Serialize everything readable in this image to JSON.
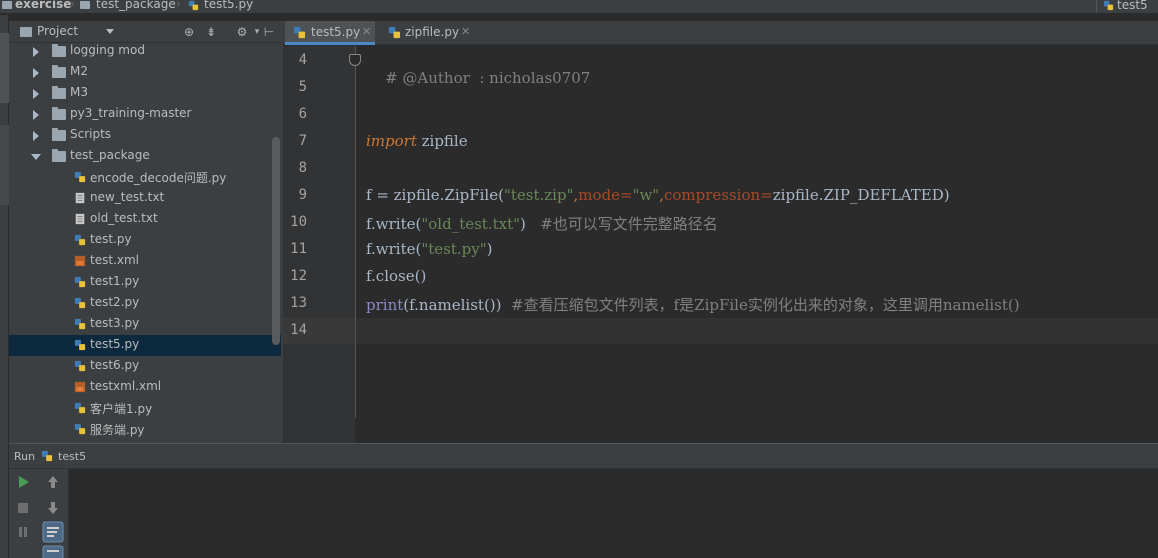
{
  "navbar": {
    "crumbs": [
      "exercise",
      "test_package",
      "test5.py"
    ],
    "run_config": "test5"
  },
  "project_panel": {
    "title": "Project",
    "tree": [
      {
        "label": "logging mod",
        "type": "folder",
        "expanded": false
      },
      {
        "label": "M2",
        "type": "folder",
        "expanded": false
      },
      {
        "label": "M3",
        "type": "folder",
        "expanded": false
      },
      {
        "label": "py3_training-master",
        "type": "folder",
        "expanded": false
      },
      {
        "label": "Scripts",
        "type": "folder",
        "expanded": false
      },
      {
        "label": "test_package",
        "type": "folder",
        "expanded": true
      },
      {
        "label": "encode_decode问题.py",
        "type": "py"
      },
      {
        "label": "new_test.txt",
        "type": "txt"
      },
      {
        "label": "old_test.txt",
        "type": "txt"
      },
      {
        "label": "test.py",
        "type": "py"
      },
      {
        "label": "test.xml",
        "type": "xml"
      },
      {
        "label": "test1.py",
        "type": "py"
      },
      {
        "label": "test2.py",
        "type": "py"
      },
      {
        "label": "test3.py",
        "type": "py"
      },
      {
        "label": "test5.py",
        "type": "py",
        "selected": true
      },
      {
        "label": "test6.py",
        "type": "py"
      },
      {
        "label": "testxml.xml",
        "type": "xml"
      },
      {
        "label": "客户端1.py",
        "type": "py"
      },
      {
        "label": "服务端.py",
        "type": "py"
      }
    ]
  },
  "tabs": [
    {
      "label": "test5.py",
      "active": true
    },
    {
      "label": "zipfile.py",
      "active": false
    }
  ],
  "editor": {
    "line_numbers": [
      "4",
      "5",
      "6",
      "7",
      "8",
      "9",
      "10",
      "11",
      "12",
      "13",
      "14"
    ],
    "lines": {
      "l4": "# @Author  : nicholas0707",
      "l7_kw": "import",
      "l7_rest": " zipfile",
      "l9_a": "f = zipfile.",
      "l9_cls": "ZipFile",
      "l9_b": "(",
      "l9_s1": "\"test.zip\"",
      "l9_c": ",",
      "l9_k1": "mode=",
      "l9_s2": "\"w\"",
      "l9_d": ",",
      "l9_k2": "compression=",
      "l9_e": "zipfile.ZIP_DEFLATED)",
      "l10_a": "f.",
      "l10_m": "write",
      "l10_b": "(",
      "l10_s": "\"old_test.txt\"",
      "l10_c": ")   ",
      "l10_cmt": "#也可以写文件完整路径名",
      "l11_a": "f.",
      "l11_m": "write",
      "l11_b": "(",
      "l11_s": "\"test.py\"",
      "l11_c": ")",
      "l12_a": "f.",
      "l12_m": "close",
      "l12_b": "()",
      "l13_bi": "print",
      "l13_a": "(f.",
      "l13_m": "namelist",
      "l13_b": "())  ",
      "l13_cmt": "#查看压缩包文件列表，f是ZipFile实例化出来的对象，这里调用namelist()"
    }
  },
  "run_panel": {
    "label": "Run",
    "config": "test5"
  },
  "colors": {
    "accent": "#4a88c7",
    "selection": "#0d293e",
    "keyword": "#cc7832",
    "string": "#6a8759",
    "comment": "#808080"
  }
}
